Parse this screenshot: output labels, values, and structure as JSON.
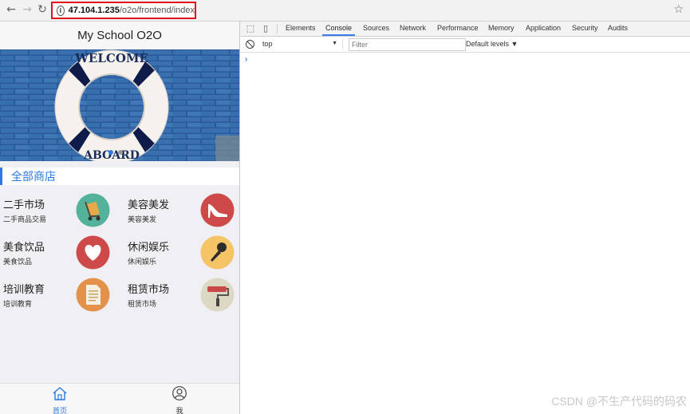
{
  "browser": {
    "url_host": "47.104.1.235",
    "url_path": "/o2o/frontend/index"
  },
  "mobile": {
    "header_title": "My School O2O",
    "banner_text_top": "WELCOME",
    "banner_text_bottom": "ABOARD",
    "section_title": "全部商店",
    "categories": [
      {
        "name": "二手市场",
        "desc": "二手商品交易",
        "icon": "cart-icon",
        "color": "#52b29a"
      },
      {
        "name": "美容美发",
        "desc": "美容美发",
        "icon": "high-heel-icon",
        "color": "#cd4a48"
      },
      {
        "name": "美食饮品",
        "desc": "美食饮品",
        "icon": "heart-icon",
        "color": "#cd4a48"
      },
      {
        "name": "休闲娱乐",
        "desc": "休闲娱乐",
        "icon": "microphone-icon",
        "color": "#f4c466"
      },
      {
        "name": "培训教育",
        "desc": "培训教育",
        "icon": "document-icon",
        "color": "#e4924b"
      },
      {
        "name": "租赁市场",
        "desc": "租赁市场",
        "icon": "paint-roller-icon",
        "color": "#dcd8c4"
      }
    ],
    "tabs": [
      {
        "label": "首页",
        "icon": "home-icon",
        "active": true
      },
      {
        "label": "我",
        "icon": "user-icon",
        "active": false
      }
    ]
  },
  "devtools": {
    "tabs": [
      "Elements",
      "Console",
      "Sources",
      "Network",
      "Performance",
      "Memory",
      "Application",
      "Security",
      "Audits"
    ],
    "active_tab": "Console",
    "context": "top",
    "filter_placeholder": "Filter",
    "levels": "Default levels ▼"
  },
  "watermark": "CSDN @不生产代码的码农",
  "colors": {
    "accent": "#2a7ae2",
    "highlight_box": "#e0101e",
    "devtools_active": "#3b7ded"
  }
}
